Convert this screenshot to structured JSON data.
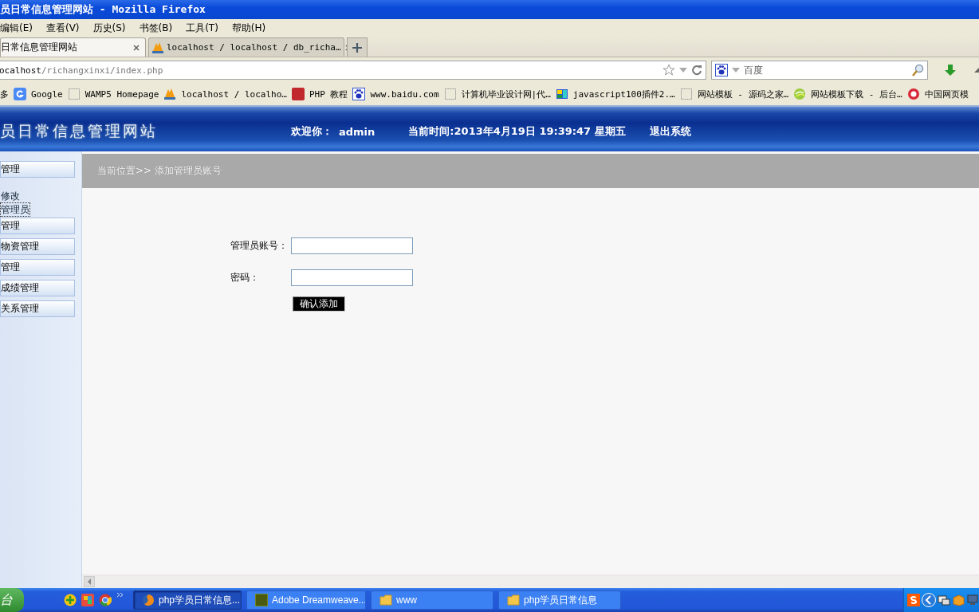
{
  "window": {
    "title": "员日常信息管理网站 - Mozilla Firefox"
  },
  "menu": [
    "编辑(E)",
    "查看(V)",
    "历史(S)",
    "书签(B)",
    "工具(T)",
    "帮助(H)"
  ],
  "tabs": [
    {
      "label": "日常信息管理网站",
      "selected": true
    },
    {
      "label": "localhost / localhost / db_richa…",
      "selected": false
    }
  ],
  "address": {
    "host": "ocalhost",
    "path": "/richangxinxi/index.php"
  },
  "search": {
    "placeholder": "百度"
  },
  "bookmarks": [
    "多",
    "Google",
    "WAMP5 Homepage",
    "localhost / localho…",
    "PHP 教程",
    "www.baidu.com",
    "计算机毕业设计网|代…",
    "javascript100插件2.…",
    "网站模板 - 源码之家…",
    "网站模板下载 - 后台…",
    "中国网页模"
  ],
  "site_header": {
    "title": "员日常信息管理网站",
    "welcome": "欢迎你：",
    "user": "admin",
    "time": "当前时间:2013年4月19日 19:39:47 星期五",
    "logout": "退出系统"
  },
  "sidebar": {
    "items": [
      {
        "kind": "section",
        "label": "管理"
      },
      {
        "kind": "link",
        "label": "修改",
        "selected": false
      },
      {
        "kind": "link",
        "label": "管理员",
        "selected": true
      },
      {
        "kind": "section",
        "label": "管理"
      },
      {
        "kind": "section",
        "label": "物资管理"
      },
      {
        "kind": "section",
        "label": "管理"
      },
      {
        "kind": "section",
        "label": "成绩管理"
      },
      {
        "kind": "section",
        "label": "关系管理"
      }
    ]
  },
  "breadcrumb": "当前位置>> 添加管理员账号",
  "form": {
    "fields": [
      {
        "label": "管理员账号："
      },
      {
        "label": "密码："
      }
    ],
    "submit": "确认添加"
  },
  "taskbar": {
    "start": "台",
    "tasks": [
      {
        "label": "php学员日常信息...",
        "selected": true
      },
      {
        "label": "Adobe Dreamweave...",
        "selected": false
      },
      {
        "label": "www",
        "selected": false
      },
      {
        "label": "php学员日常信息",
        "selected": false
      }
    ]
  }
}
